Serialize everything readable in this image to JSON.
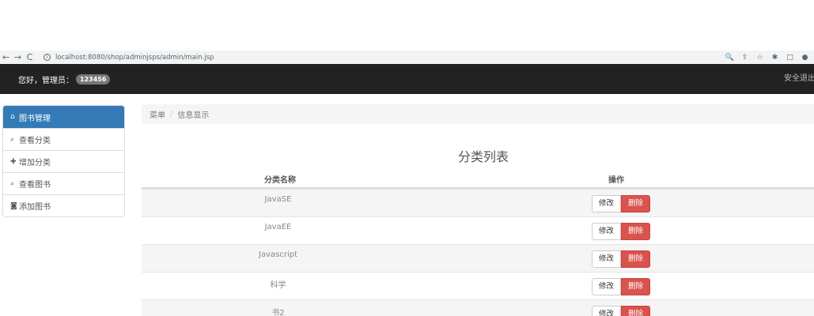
{
  "browser": {
    "back_icon": "←",
    "forward_icon": "→",
    "reload_icon": "C",
    "url": "localhost:8080/shop/adminjsps/admin/main.jsp",
    "toolbar_icons": [
      "🔍",
      "⇪",
      "☆",
      "✱",
      "□",
      "●"
    ]
  },
  "navbar": {
    "greeting": "您好，管理员：",
    "username": "123456",
    "logout": "安全退出"
  },
  "sidebar": {
    "items": [
      {
        "icon": "⌂",
        "label": "图书管理"
      },
      {
        "icon": "⌕",
        "label": "查看分类"
      },
      {
        "icon": "✚",
        "label": "增加分类"
      },
      {
        "icon": "⌕",
        "label": "查看图书"
      },
      {
        "icon": "◙",
        "label": "添加图书"
      }
    ]
  },
  "breadcrumb": {
    "items": [
      "菜单",
      "信息显示"
    ],
    "separator": "/"
  },
  "table": {
    "title": "分类列表",
    "headers": [
      "分类名称",
      "操作"
    ],
    "rows": [
      {
        "name": "JavaSE",
        "edit": "修改",
        "delete": "删除"
      },
      {
        "name": "JavaEE",
        "edit": "修改",
        "delete": "删除"
      },
      {
        "name": "Javascript",
        "edit": "修改",
        "delete": "删除"
      },
      {
        "name": "科学",
        "edit": "修改",
        "delete": "删除"
      },
      {
        "name": "书2",
        "edit": "修改",
        "delete": "删除"
      }
    ]
  },
  "colors": {
    "navbar_bg": "#222222",
    "active_blue": "#337ab7",
    "danger_red": "#d9534f"
  }
}
